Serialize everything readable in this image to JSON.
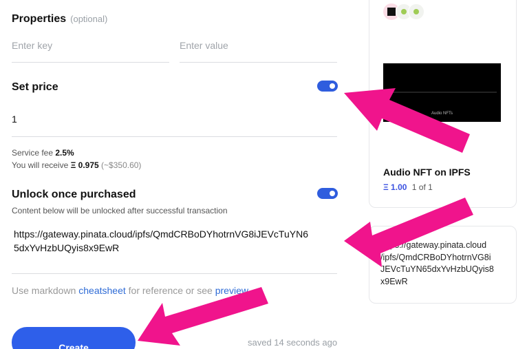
{
  "form": {
    "properties_label": "Properties",
    "properties_optional": "(optional)",
    "key_placeholder": "Enter key",
    "value_placeholder": "Enter value",
    "set_price_label": "Set price",
    "set_price_enabled": true,
    "price_value": "1",
    "service_fee_label": "Service fee",
    "service_fee_value": "2.5%",
    "receive_label": "You will receive",
    "receive_value": "Ξ 0.975",
    "receive_usd": "(~$350.60)",
    "unlock_label": "Unlock once purchased",
    "unlock_enabled": true,
    "unlock_hint": "Content below will be unlocked after successful transaction",
    "unlock_content_line1": "https://gateway.pinata.cloud/ipfs/QmdCRBoDYhotrnVG8iJEVcTuYN6",
    "unlock_content_line2": "5dxYvHzbUQyis8x9EwR",
    "markdown_prefix": "Use markdown",
    "markdown_link": "cheatsheet",
    "markdown_middle": "for reference or see",
    "preview_link": "preview",
    "create_button": "Create",
    "saved_status": "saved 14 seconds ago"
  },
  "preview": {
    "nft_image_caption": "Audio NFTs",
    "nft_title": "Audio NFT on IPFS",
    "price": "Ξ 1.00",
    "edition": "1 of 1",
    "unlock_text_lines": [
      "https://gateway.pinata.cloud",
      "/ipfs/QmdCRBoDYhotrnVG8i",
      "JEVcTuYN65dxYvHzbUQyis8",
      "x9EwR"
    ]
  },
  "colors": {
    "accent": "#2e5fea",
    "toggle": "#2f5dde",
    "annotation_arrow": "#f0148c",
    "eth": "#3b52e0"
  }
}
